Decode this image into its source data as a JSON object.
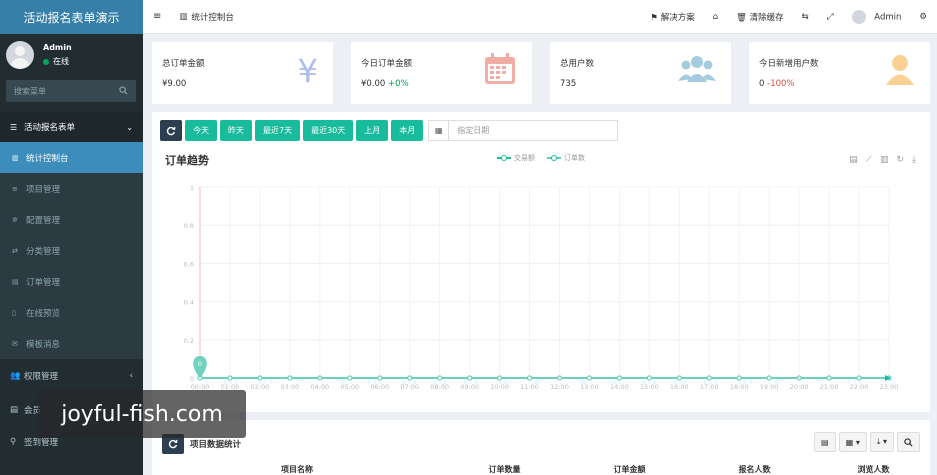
{
  "sidebar": {
    "brand": "活动报名表单演示",
    "user_name": "Admin",
    "user_status": "在线",
    "search_placeholder": "搜索菜单",
    "group_main": "活动报名表单",
    "items": [
      {
        "label": "统计控制台",
        "icon": "bar-chart-icon",
        "active": true
      },
      {
        "label": "项目管理",
        "icon": "list-icon"
      },
      {
        "label": "配置管理",
        "icon": "gear-icon"
      },
      {
        "label": "分类管理",
        "icon": "shuffle-icon"
      },
      {
        "label": "订单管理",
        "icon": "document-icon"
      },
      {
        "label": "在线预览",
        "icon": "phone-icon"
      },
      {
        "label": "模板消息",
        "icon": "envelope-icon"
      }
    ],
    "group_auth": "权限管理",
    "group_member": "会员",
    "group_signin": "签到管理"
  },
  "topbar": {
    "tab": "统计控制台",
    "solutions": "解决方案",
    "clear_cache": "清除缓存",
    "user": "Admin"
  },
  "cards": [
    {
      "label": "总订单金额",
      "value": "¥9.00",
      "change": "",
      "icon": "yen-icon",
      "color": "#4a6fd8"
    },
    {
      "label": "今日订单金额",
      "value": "¥0.00",
      "change": "+0%",
      "icon": "calendar-icon",
      "color": "#dd4b39"
    },
    {
      "label": "总用户数",
      "value": "735",
      "change": "",
      "icon": "users-icon",
      "color": "#3c8dbc"
    },
    {
      "label": "今日新增用户数",
      "value": "0",
      "change": "-100%",
      "icon": "user-icon",
      "color": "#f39c12"
    }
  ],
  "filters": {
    "today": "今天",
    "yesterday": "昨天",
    "last7": "最近7天",
    "last30": "最近30天",
    "last_month": "上月",
    "this_month": "本月",
    "date_placeholder": "指定日期"
  },
  "chart": {
    "title": "订单趋势",
    "legend": [
      "交易额",
      "订单数"
    ]
  },
  "chart_data": {
    "type": "line",
    "x": [
      "00:00",
      "01:00",
      "02:00",
      "03:00",
      "04:00",
      "05:00",
      "06:00",
      "07:00",
      "08:00",
      "09:00",
      "10:00",
      "11:00",
      "12:00",
      "13:00",
      "14:00",
      "15:00",
      "16:00",
      "17:00",
      "18:00",
      "19:00",
      "20:00",
      "21:00",
      "22:00",
      "23:00"
    ],
    "series": [
      {
        "name": "交易额",
        "values": [
          0,
          0,
          0,
          0,
          0,
          0,
          0,
          0,
          0,
          0,
          0,
          0,
          0,
          0,
          0,
          0,
          0,
          0,
          0,
          0,
          0,
          0,
          0,
          0
        ]
      },
      {
        "name": "订单数",
        "values": [
          0,
          0,
          0,
          0,
          0,
          0,
          0,
          0,
          0,
          0,
          0,
          0,
          0,
          0,
          0,
          0,
          0,
          0,
          0,
          0,
          0,
          0,
          0,
          0
        ]
      }
    ],
    "yticks": [
      "0",
      "0.2",
      "0.4",
      "0.6",
      "0.8",
      "1"
    ],
    "ylim": [
      0,
      1
    ],
    "marker_label": "0",
    "grid": true
  },
  "table": {
    "title": "项目数据统计",
    "columns": [
      "项目名称",
      "订单数量",
      "订单金额",
      "报名人数",
      "浏览人数"
    ]
  },
  "watermark": "joyful-fish.com"
}
